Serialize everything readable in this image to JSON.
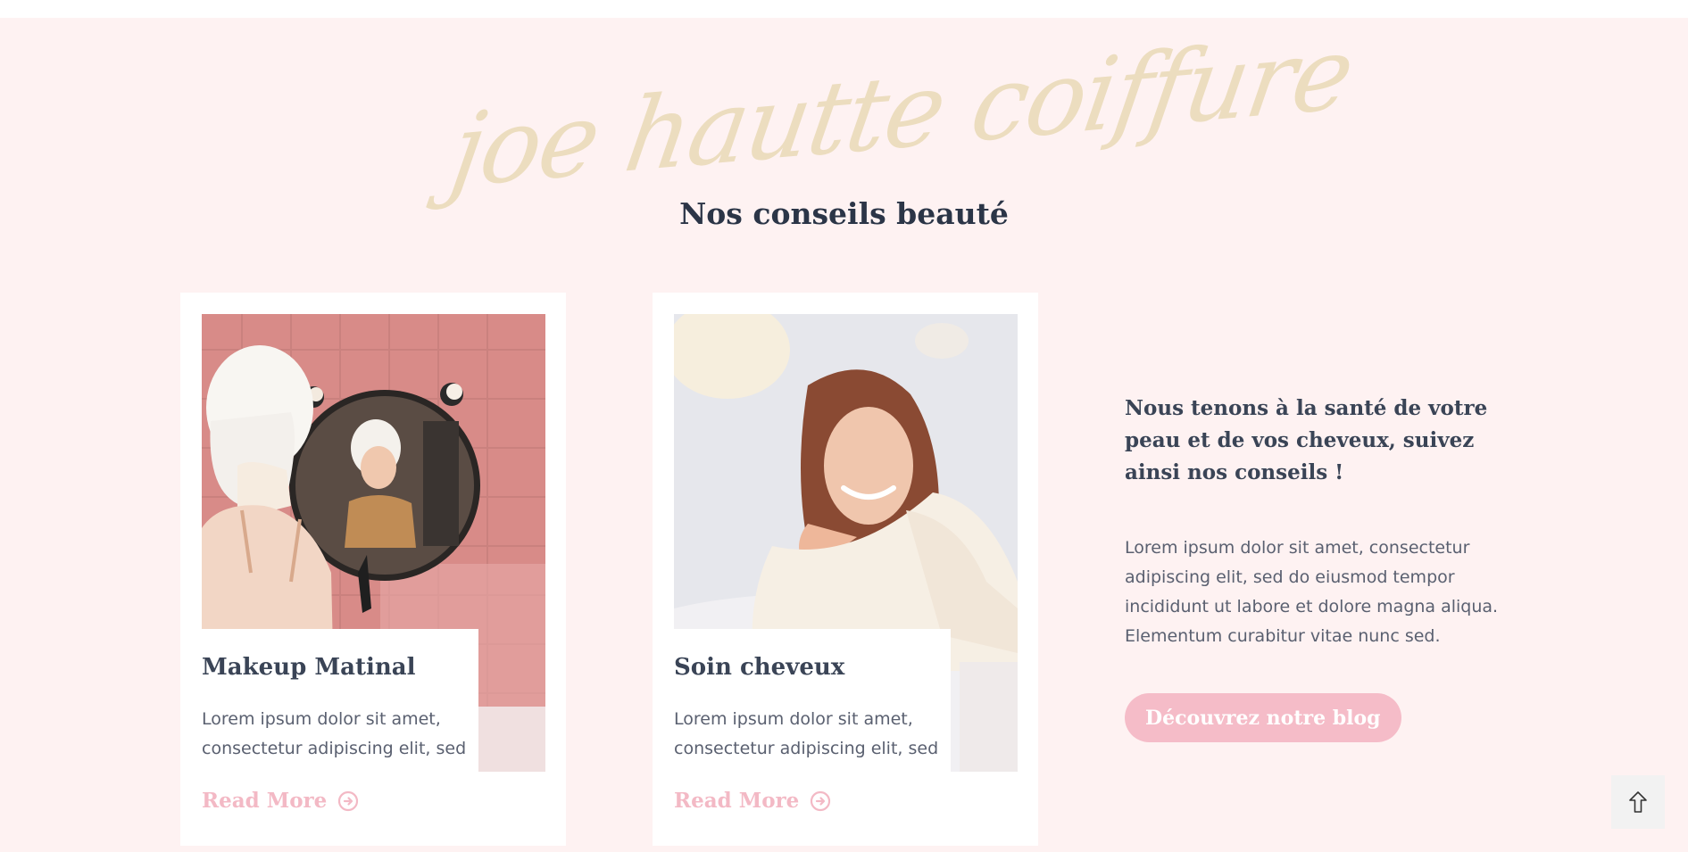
{
  "header": {
    "script_title": "joe hautte coiffure",
    "section_title": "Nos conseils beauté"
  },
  "cards": [
    {
      "title": "Makeup Matinal",
      "excerpt": "Lorem ipsum dolor sit amet, consectetur adipiscing elit, sed",
      "read_more": "Read More",
      "icon": "arrow-circle-right-icon"
    },
    {
      "title": "Soin cheveux",
      "excerpt": "Lorem ipsum dolor sit amet, consectetur adipiscing elit, sed",
      "read_more": "Read More",
      "icon": "arrow-circle-right-icon"
    }
  ],
  "aside": {
    "heading": "Nous tenons à la santé de votre peau et de vos cheveux, suivez ainsi nos conseils !",
    "text": "Lorem ipsum dolor sit amet, consectetur adipiscing elit, sed do eiusmod tempor incididunt ut labore et dolore magna aliqua. Elementum curabitur vitae nunc sed.",
    "button_label": "Découvrez notre blog"
  },
  "scroll_top_icon": "arrow-up-icon",
  "colors": {
    "section_bg": "#fef2f2",
    "accent_pink": "#f5bcc8",
    "script_gold": "#ecdcbd",
    "heading_dark": "#2b3547"
  }
}
